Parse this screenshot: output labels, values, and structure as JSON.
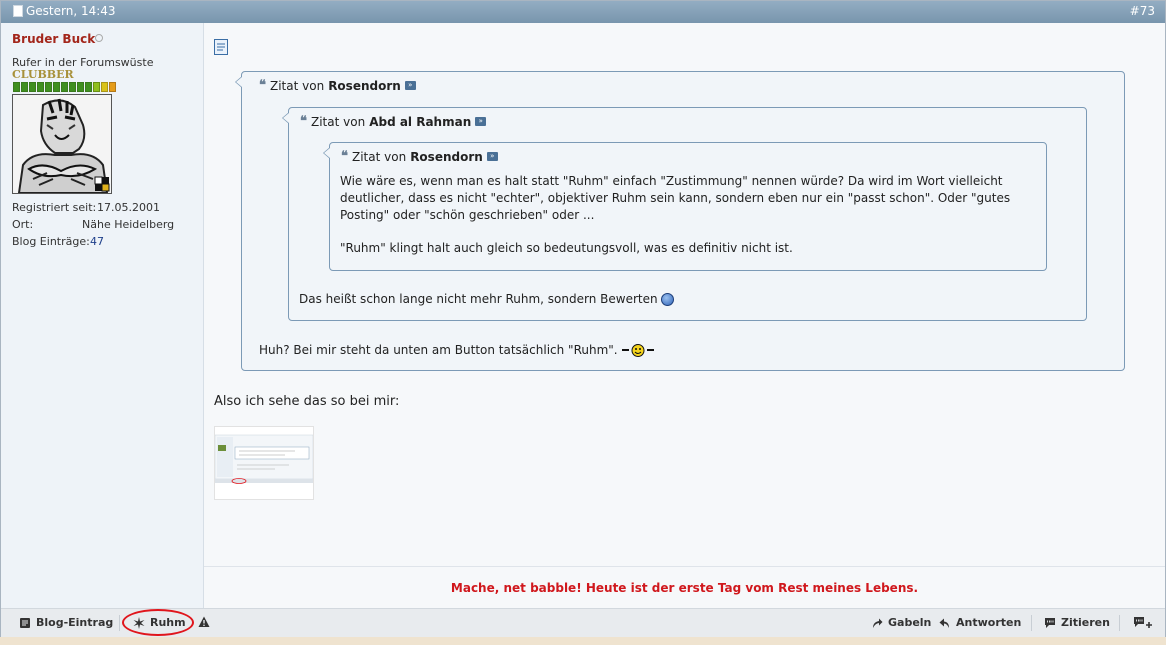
{
  "header": {
    "date": "Gestern, 14:43",
    "post_number": "#73"
  },
  "user": {
    "name": "Bruder Buck",
    "title": "Rufer in der Forumswüste",
    "rank_label": "CLUBBER",
    "registered_label": "Registriert seit:",
    "registered_value": "17.05.2001",
    "location_label": "Ort:",
    "location_value": "Nähe Heidelberg",
    "blog_label": "Blog Einträge:",
    "blog_value": "47"
  },
  "quotes": {
    "prefix": "Zitat von",
    "q1_author": "Rosendorn",
    "q2_author": "Abd al Rahman",
    "q3_author": "Rosendorn",
    "q3_text_1": "Wie wäre es, wenn man es halt statt \"Ruhm\" einfach \"Zustimmung\" nennen würde? Da wird im Wort vielleicht deutlicher, dass es nicht \"echter\", objektiver Ruhm sein kann, sondern eben nur ein \"passt schon\". Oder \"gutes Posting\" oder \"schön geschrieben\" oder ...",
    "q3_text_2": "\"Ruhm\" klingt halt auch gleich so bedeutungsvoll, was es definitiv nicht ist.",
    "q2_text": "Das heißt schon lange nicht mehr Ruhm, sondern Bewerten",
    "q1_text": "Huh? Bei mir steht da unten am Button tatsächlich \"Ruhm\"."
  },
  "body_text": "Also ich sehe das so bei mir:",
  "signature": "Mache, net babble! Heute ist der erste Tag vom Rest meines Lebens.",
  "footer": {
    "blog": "Blog-Eintrag",
    "ruhm": "Ruhm",
    "gabeln": "Gabeln",
    "antworten": "Antworten",
    "zitieren": "Zitieren"
  },
  "colors": {
    "username": "#a3261b",
    "signature": "#d0181d",
    "highlight_ring": "#e0151c",
    "header_bar": "#7f9ab2"
  }
}
